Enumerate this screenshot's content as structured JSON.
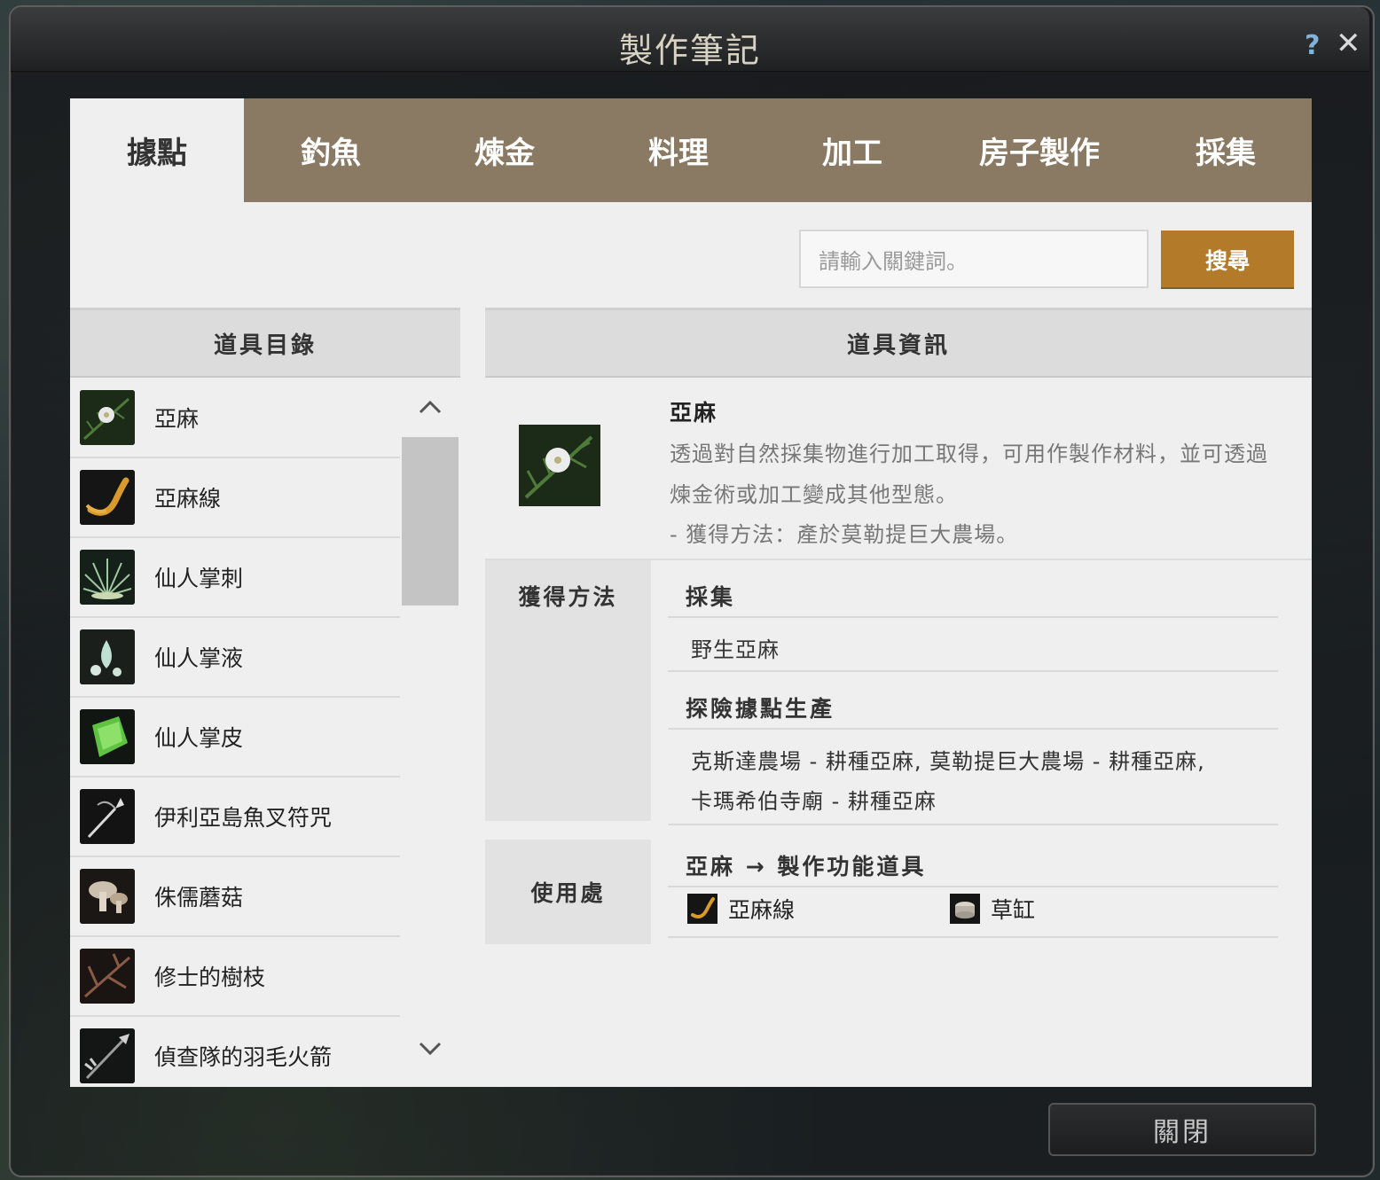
{
  "window": {
    "title": "製作筆記"
  },
  "tabs": [
    "據點",
    "釣魚",
    "煉金",
    "料理",
    "加工",
    "房子製作",
    "採集"
  ],
  "search": {
    "placeholder": "請輸入關鍵詞。",
    "button": "搜尋"
  },
  "item_list": {
    "header": "道具目錄",
    "items": [
      {
        "label": "亞麻",
        "icon": "flax-flower-icon"
      },
      {
        "label": "亞麻線",
        "icon": "flax-thread-icon"
      },
      {
        "label": "仙人掌刺",
        "icon": "cactus-thorn-icon"
      },
      {
        "label": "仙人掌液",
        "icon": "cactus-sap-icon"
      },
      {
        "label": "仙人掌皮",
        "icon": "cactus-skin-icon"
      },
      {
        "label": "伊利亞島魚叉符咒",
        "icon": "harpoon-charm-icon"
      },
      {
        "label": "侏儒蘑菇",
        "icon": "mushroom-icon"
      },
      {
        "label": "修士的樹枝",
        "icon": "branch-icon"
      },
      {
        "label": "偵查隊的羽毛火箭",
        "icon": "feather-rocket-icon"
      }
    ]
  },
  "item_info": {
    "header": "道具資訊",
    "name": "亞麻",
    "description": "透過對自然採集物進行加工取得，可用作製作材料，並可透過煉金術或加工變成其他型態。",
    "obtain_note": "- 獲得方法：產於莫勒提巨大農場。",
    "obtain_label": "獲得方法",
    "sections": [
      {
        "title": "採集",
        "lines": [
          "野生亞麻"
        ]
      },
      {
        "title": "探險據點生產",
        "lines": [
          "克斯達農場 - 耕種亞麻, 莫勒提巨大農場 - 耕種亞麻,",
          "卡瑪希伯寺廟 - 耕種亞麻"
        ]
      }
    ],
    "use_label": "使用處",
    "use_title": "亞麻 → 製作功能道具",
    "uses": [
      {
        "label": "亞麻線",
        "icon": "flax-thread-icon"
      },
      {
        "label": "草缸",
        "icon": "grass-pot-icon"
      }
    ]
  },
  "footer": {
    "close_button": "關閉"
  }
}
